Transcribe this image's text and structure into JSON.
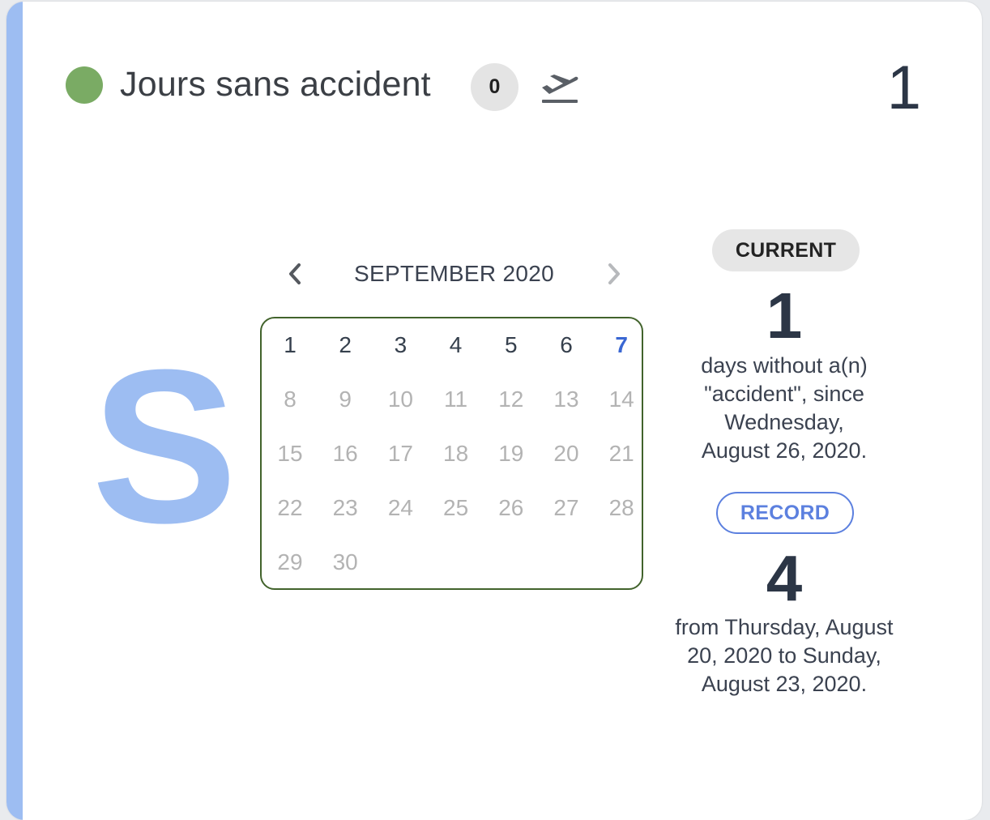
{
  "header": {
    "title": "Jours sans accident",
    "badge_count": "0",
    "status_color": "#7aab64",
    "status_icon": "status-dot",
    "action_icon": "takeoff-icon",
    "top_count": "1"
  },
  "avatar": {
    "letter": "S",
    "color": "#9dbdf2"
  },
  "calendar": {
    "month_label": "SEPTEMBER 2020",
    "prev_icon": "chevron-left-icon",
    "next_icon": "chevron-right-icon",
    "border_color": "#42632c",
    "today": "7",
    "weeks": [
      [
        "1",
        "2",
        "3",
        "4",
        "5",
        "6",
        "7"
      ],
      [
        "8",
        "9",
        "10",
        "11",
        "12",
        "13",
        "14"
      ],
      [
        "15",
        "16",
        "17",
        "18",
        "19",
        "20",
        "21"
      ],
      [
        "22",
        "23",
        "24",
        "25",
        "26",
        "27",
        "28"
      ],
      [
        "29",
        "30"
      ]
    ]
  },
  "current": {
    "label": "CURRENT",
    "value": "1",
    "desc_lines": [
      "days without a(n)",
      "\"accident\", since",
      "Wednesday,",
      "August 26, 2020."
    ]
  },
  "record": {
    "label": "RECORD",
    "value": "4",
    "desc_lines": [
      "from Thursday, August",
      "20, 2020 to Sunday,",
      "August 23, 2020."
    ]
  }
}
